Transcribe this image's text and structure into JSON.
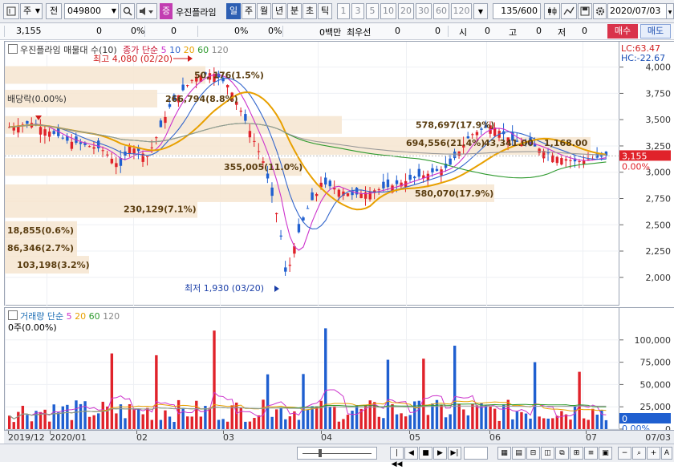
{
  "toolbar": {
    "market_label": "주",
    "prev_label": "전",
    "code_value": "049800",
    "pink_badge": "증",
    "stock_name": "우진플라임",
    "periods": [
      "일",
      "주",
      "월",
      "년",
      "분",
      "초",
      "틱"
    ],
    "active_period": "일",
    "numbers": [
      "1",
      "3",
      "5",
      "10",
      "20",
      "30",
      "60",
      "120"
    ],
    "count_value": "135",
    "count_total": "/600",
    "date_value": "2020/07/03"
  },
  "quote": {
    "price": "3,155",
    "change": "0",
    "change_pct": "0%",
    "volume": "0",
    "volume_pct": "0%",
    "vol_unit": "0백만",
    "best_label": "최우선",
    "best_ask": "0",
    "best_bid": "0",
    "open_label": "시",
    "open_val": "0",
    "high_label": "고",
    "high_val": "0",
    "low_label": "저",
    "low_val": "0",
    "buy_label": "매수",
    "sell_label": "매도"
  },
  "price_pane": {
    "title": "우진플라임 매물대 수(10)",
    "ma_label": "종가 단순",
    "ma_periods": [
      "5",
      "10",
      "20",
      "60",
      "120"
    ],
    "ma_colors": [
      "#cc33cc",
      "#3366cc",
      "#e8a000",
      "#2e9a2e",
      "#888888"
    ],
    "lc_label": "LC:63.47",
    "hc_label": "HC:-22.67",
    "high_note": "최고 4,080 (02/20)",
    "low_note": "최저 1,930 (03/20)",
    "dividend_note": "배당락(0.00%)",
    "current_price_tag": "3,155",
    "current_pct_tag": "0.00%",
    "y_ticks": [
      "4,000",
      "3,750",
      "3,500",
      "3,250",
      "3,000",
      "2,750",
      "2,500",
      "2,250",
      "2,000"
    ],
    "volume_profile": [
      {
        "price": 3925,
        "label": "50, 176(1.5%)"
      },
      {
        "price": 3700,
        "label": "266,794(8.8%)"
      },
      {
        "price": 3450,
        "label": "578,697(17.9%)"
      },
      {
        "price": 3250,
        "label": "694,556(21.4%)"
      },
      {
        "price": 3250,
        "label": "43,341.00"
      },
      {
        "price": 3250,
        "label": "1,168.00"
      },
      {
        "price": 3050,
        "label": "355,005(11.0%)"
      },
      {
        "price": 2800,
        "label": "580,070(17.9%)"
      },
      {
        "price": 2650,
        "label": "230,129(7.1%)"
      },
      {
        "price": 2450,
        "label": "18,855(0.6%)"
      },
      {
        "price": 2280,
        "label": "86,346(2.7%)"
      },
      {
        "price": 2120,
        "label": "103,198(3.2%)"
      }
    ]
  },
  "volume_pane": {
    "title": "거래량 단순",
    "ma_periods": [
      "5",
      "20",
      "60",
      "120"
    ],
    "ma_colors": [
      "#cc33cc",
      "#e8a000",
      "#2e9a2e",
      "#888888"
    ],
    "sub_label": "0주(0.00%)",
    "y_ticks": [
      "100,000",
      "75,000",
      "50,000",
      "25,000",
      "0"
    ],
    "current_tag": "0",
    "current_pct_tag": "0.00%"
  },
  "date_axis": {
    "labels": [
      "2019/12",
      "2020/01",
      "02",
      "03",
      "04",
      "05",
      "06",
      "07"
    ],
    "corner_date": "07/03"
  },
  "chart_data": {
    "type": "candlestick",
    "title": "우진플라임 (049800)",
    "period": "daily",
    "y_range": [
      1800,
      4150
    ],
    "volume_range": [
      0,
      125000
    ],
    "monthly_closes": [
      {
        "month": "2019/12",
        "close": 3420
      },
      {
        "month": "2020/01",
        "close": 3150
      },
      {
        "month": "2020/02",
        "close": 3880
      },
      {
        "month": "2020/03",
        "close": 2450
      },
      {
        "month": "2020/04",
        "close": 2870
      },
      {
        "month": "2020/05",
        "close": 2950
      },
      {
        "month": "2020/06",
        "close": 3200
      },
      {
        "month": "2020/07",
        "close": 3155
      }
    ],
    "high": {
      "value": 4080,
      "date": "02/20"
    },
    "low": {
      "value": 1930,
      "date": "03/20"
    }
  }
}
